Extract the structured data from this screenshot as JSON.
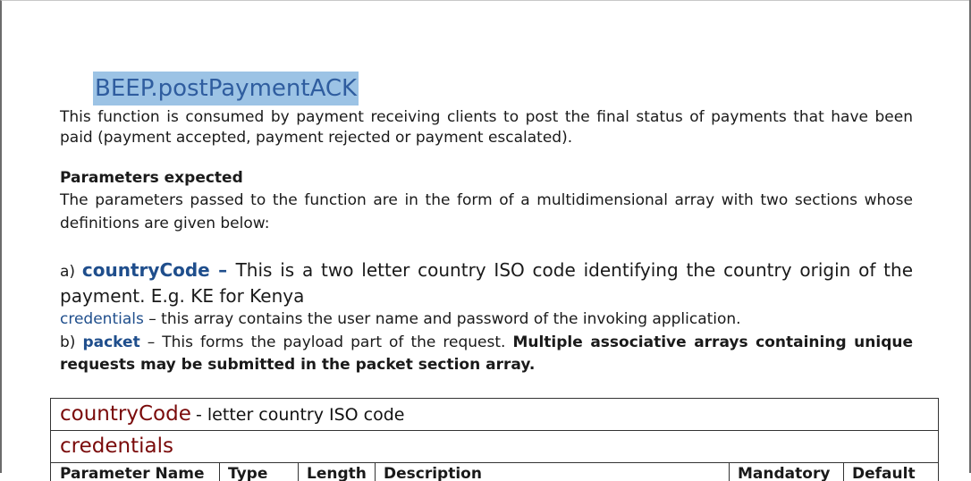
{
  "title": "BEEP.postPaymentACK",
  "intro": {
    "line1": "This function is consumed by payment receiving clients to post the final status of payments that have been",
    "line2": "paid (payment accepted,  payment rejected or payment escalated)."
  },
  "params": {
    "heading": "Parameters expected",
    "line1": "The parameters passed to the function are in the form of a multidimensional array with two sections whose",
    "line2": "definitions are given below:"
  },
  "item_a": {
    "prefix": "a) ",
    "name": "countryCode",
    "dash": " – ",
    "text1": "This is a two letter country ISO code identifying the country origin of the",
    "text2": "payment. E.g. KE for Kenya"
  },
  "item_cred": {
    "name": "credentials",
    "text": " – this array contains the user name and password of the invoking application."
  },
  "item_b": {
    "prefix": "b) ",
    "name": "packet",
    "text1": " – This forms the payload part of the request. ",
    "bold1": "Multiple associative arrays containing unique",
    "bold2": "requests may be submitted in the packet section array."
  },
  "table": {
    "row1_name": "countryCode",
    "row1_rest": " -  letter country ISO code",
    "row2_name": "credentials",
    "headers": [
      "Parameter Name",
      "Type",
      "Length",
      "Description",
      "Mandatory",
      "Default"
    ]
  }
}
